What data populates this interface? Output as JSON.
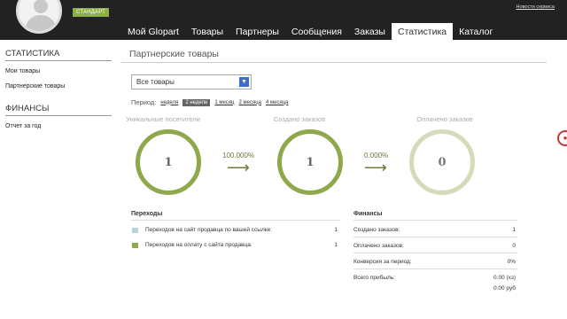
{
  "header": {
    "plan_badge": "СТАНДАРТ",
    "top_link": "Новости сервиса"
  },
  "nav": {
    "items": [
      "Мой Glopart",
      "Товары",
      "Партнеры",
      "Сообщения",
      "Заказы",
      "Статистика",
      "Каталог"
    ],
    "active": "Статистика"
  },
  "sidebar": {
    "stats_heading": "СТАТИСТИКА",
    "stats_links": [
      "Мои товары",
      "Партнерские товары"
    ],
    "finance_heading": "ФИНАНСЫ",
    "finance_links": [
      "Отчет за год"
    ]
  },
  "main": {
    "title": "Партнерские товары",
    "select_value": "Все товары",
    "period_label": "Период:",
    "period_options": [
      "неделя",
      "2 недели",
      "1 месяц",
      "2 месяца",
      "4 месяца"
    ],
    "period_selected": "2 недели"
  },
  "funnel": {
    "visitors_label": "Уникальные посетители",
    "visitors_value": "1",
    "conversion1": "100.000%",
    "orders_label": "Создано заказов",
    "orders_value": "1",
    "conversion2": "0.000%",
    "paid_label": "Оплачено заказов",
    "paid_value": "0"
  },
  "transitions": {
    "heading": "Переходы",
    "rows": [
      {
        "label": "Переходов на сайт продавца по вашей ссылке:",
        "value": "1",
        "color": "#b8d3dc"
      },
      {
        "label": "Переходов на оплату с сайта продавца:",
        "value": "1",
        "color": "#8fa84c"
      }
    ]
  },
  "finance": {
    "heading": "Финансы",
    "rows": [
      {
        "label": "Создано заказов:",
        "value": "1"
      },
      {
        "label": "Оплачено заказов:",
        "value": "0"
      },
      {
        "label": "Конверсия за период:",
        "value": "0%"
      },
      {
        "label": "Всего прибыль:",
        "value": "0.00 (хз)"
      }
    ],
    "extra_value": "0.00 руб"
  },
  "colors": {
    "topbar": "#222222",
    "accent": "#8fa84c",
    "badge": "#8cb044"
  }
}
